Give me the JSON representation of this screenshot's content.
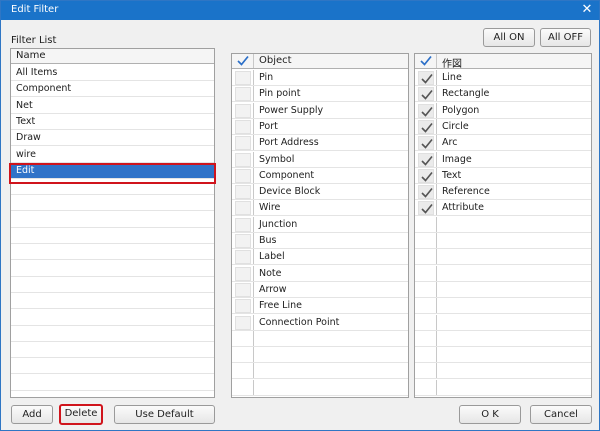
{
  "window": {
    "title": "Edit Filter",
    "close_glyph": "✕"
  },
  "filter_list": {
    "label": "Filter List",
    "header": "Name",
    "items": [
      "All Items",
      "Component",
      "Net",
      "Text",
      "Draw",
      "wire",
      "Edit"
    ],
    "selected": "Edit"
  },
  "toolbar": {
    "all_on": "All ON",
    "all_off": "All OFF"
  },
  "object_grid": {
    "header": "Object",
    "items": [
      "Pin",
      "Pin point",
      "Power Supply",
      "Port",
      "Port Address",
      "Symbol",
      "Component",
      "Device Block",
      "Wire",
      "Junction",
      "Bus",
      "Label",
      "Note",
      "Arrow",
      "Free Line",
      "Connection Point"
    ]
  },
  "draw_grid": {
    "header": "作図",
    "items": [
      "Line",
      "Rectangle",
      "Polygon",
      "Circle",
      "Arc",
      "Image",
      "Text",
      "Reference",
      "Attribute"
    ]
  },
  "buttons": {
    "add": "Add",
    "delete": "Delete",
    "use_default": "Use Default",
    "ok": "O K",
    "cancel": "Cancel"
  },
  "colors": {
    "titlebar": "#1a73c9",
    "selection": "#3073c8",
    "highlight": "#d0141c",
    "check_blue": "#2b6fc8"
  }
}
